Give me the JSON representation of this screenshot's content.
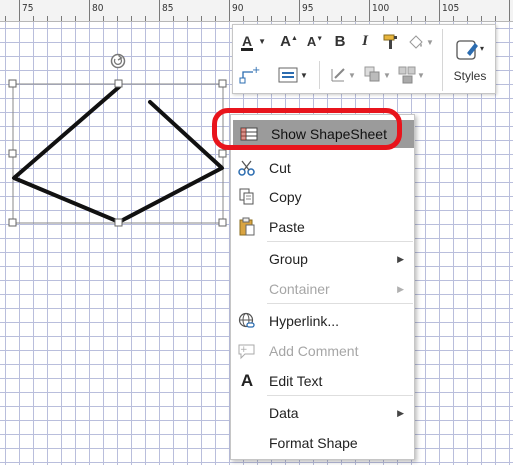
{
  "ruler": {
    "labels": [
      "75",
      "80",
      "85",
      "90",
      "95",
      "100",
      "105"
    ]
  },
  "minitoolbar": {
    "font_color_icon": "A",
    "grow_font_icon": "A",
    "shrink_font_icon": "A",
    "bold_label": "B",
    "italic_label": "I",
    "styles_label": "Styles"
  },
  "context_menu": {
    "items": [
      {
        "label": "Show ShapeSheet",
        "icon": "shapesheet-icon",
        "enabled": true,
        "highlighted": true
      },
      {
        "label": "Cut",
        "icon": "scissors-icon",
        "enabled": true
      },
      {
        "label": "Copy",
        "icon": "copy-icon",
        "enabled": true
      },
      {
        "label": "Paste",
        "icon": "paste-icon",
        "enabled": true
      },
      {
        "label": "Group",
        "enabled": true,
        "submenu": true
      },
      {
        "label": "Container",
        "enabled": false,
        "submenu": true
      },
      {
        "label": "Hyperlink...",
        "icon": "hyperlink-icon",
        "enabled": true
      },
      {
        "label": "Add Comment",
        "icon": "comment-icon",
        "enabled": false
      },
      {
        "label": "Edit Text",
        "icon": "edit-text-icon",
        "enabled": true
      },
      {
        "label": "Data",
        "enabled": true,
        "submenu": true
      },
      {
        "label": "Format Shape",
        "enabled": true
      }
    ]
  },
  "colors": {
    "highlight": "#9b9b9b",
    "annotation_ring": "#e8141c",
    "grid_line": "#b9bedc"
  }
}
